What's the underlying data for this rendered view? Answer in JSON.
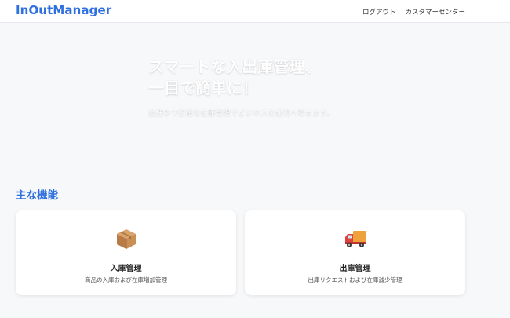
{
  "header": {
    "logo": "InOutManager",
    "nav": [
      {
        "label": "ログアウト"
      },
      {
        "label": "カスタマーセンター"
      }
    ]
  },
  "hero": {
    "title_line1": "スマートな入出庫管理、",
    "title_line2": "一目で簡単に！",
    "subtitle": "迅速かつ正確な在庫管理でビジネスを成功へ導きます。"
  },
  "features": {
    "title": "主な機能",
    "cards": [
      {
        "icon": "package-box-icon",
        "title": "入庫管理",
        "description": "商品の入庫および在庫増加管理"
      },
      {
        "icon": "delivery-truck-icon",
        "title": "出庫管理",
        "description": "出庫リクエストおよび在庫減少管理"
      }
    ]
  },
  "colors": {
    "brand": "#2f6fdf",
    "background": "#f7f8fa",
    "card": "#ffffff"
  }
}
